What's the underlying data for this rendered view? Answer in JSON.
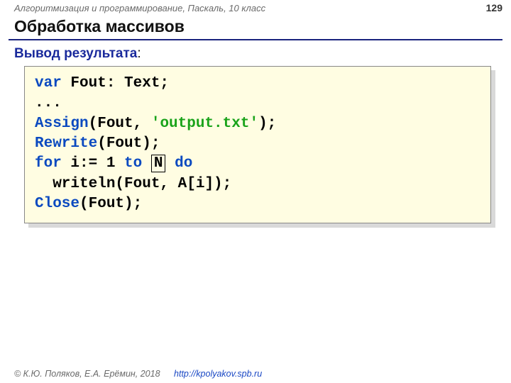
{
  "header": {
    "course": "Алгоритмизация и программирование, Паскаль, 10 класс",
    "page": "129"
  },
  "title": "Обработка массивов",
  "subtitle": "Вывод результата",
  "code": {
    "l1_a": "var",
    "l1_b": " Fout: Text;",
    "l2": "...",
    "l3_a": "Assign",
    "l3_b": "(Fout, ",
    "l3_c": "'output.txt'",
    "l3_d": ");",
    "l4_a": "Rewrite",
    "l4_b": "(Fout);",
    "l5_a": "for",
    "l5_b": " i:=",
    "l5_c": " 1 ",
    "l5_d": "to",
    "l5_e": " ",
    "l5_box": "N",
    "l5_f": " ",
    "l5_g": "do",
    "l6": "  writeln(Fout, A[i]);",
    "l7_a": "Close",
    "l7_b": "(Fout);"
  },
  "footer": {
    "copyright": "© К.Ю. Поляков, Е.А. Ерёмин, 2018",
    "url": "http://kpolyakov.spb.ru"
  }
}
